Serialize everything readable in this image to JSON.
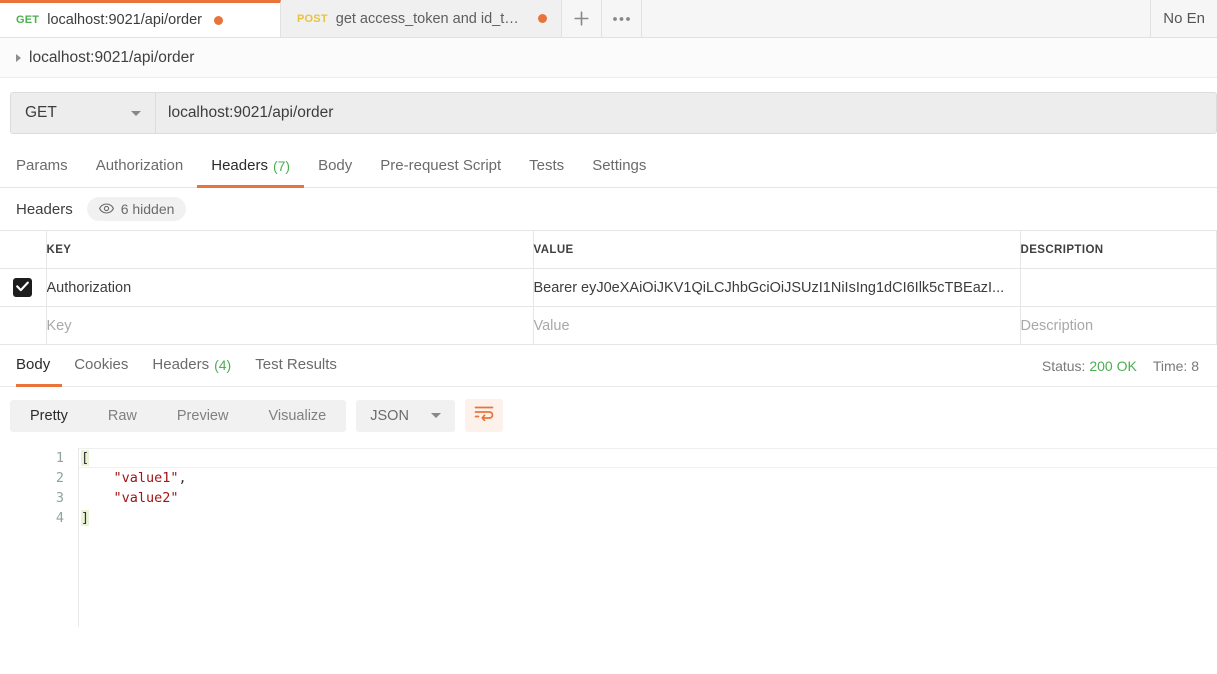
{
  "tabbar": {
    "tabs": [
      {
        "method": "GET",
        "title": "localhost:9021/api/order",
        "unsaved": true,
        "active": true
      },
      {
        "method": "POST",
        "title": "get access_token and id_token",
        "unsaved": true,
        "active": false
      }
    ],
    "new_tab_label": "+",
    "more_label": "•••",
    "environment": "No En"
  },
  "breadcrumb": {
    "text": "localhost:9021/api/order"
  },
  "urlbar": {
    "method": "GET",
    "url": "localhost:9021/api/order"
  },
  "request_tabs": [
    {
      "label": "Params",
      "count": "",
      "active": false
    },
    {
      "label": "Authorization",
      "count": "",
      "active": false
    },
    {
      "label": "Headers",
      "count": "(7)",
      "active": true
    },
    {
      "label": "Body",
      "count": "",
      "active": false
    },
    {
      "label": "Pre-request Script",
      "count": "",
      "active": false
    },
    {
      "label": "Tests",
      "count": "",
      "active": false
    },
    {
      "label": "Settings",
      "count": "",
      "active": false
    }
  ],
  "headers_sub": {
    "title": "Headers",
    "hidden_label": "6 hidden"
  },
  "headers_table": {
    "columns": [
      "KEY",
      "VALUE",
      "DESCRIPTION"
    ],
    "rows": [
      {
        "checked": true,
        "key": "Authorization",
        "value": "Bearer eyJ0eXAiOiJKV1QiLCJhbGciOiJSUzI1NiIsIng1dCI6Ilk5cTBEazI...",
        "description": ""
      }
    ],
    "placeholder_row": {
      "key": "Key",
      "value": "Value",
      "description": "Description"
    }
  },
  "response_tabs": [
    {
      "label": "Body",
      "count": "",
      "active": true
    },
    {
      "label": "Cookies",
      "count": "",
      "active": false
    },
    {
      "label": "Headers",
      "count": "(4)",
      "active": false
    },
    {
      "label": "Test Results",
      "count": "",
      "active": false
    }
  ],
  "response_meta": {
    "status_label": "Status:",
    "status_value": "200 OK",
    "time_label": "Time:",
    "time_value": "8"
  },
  "view_toolbar": {
    "segments": [
      {
        "label": "Pretty",
        "active": true
      },
      {
        "label": "Raw",
        "active": false
      },
      {
        "label": "Preview",
        "active": false
      },
      {
        "label": "Visualize",
        "active": false
      }
    ],
    "format": "JSON",
    "wrap_icon": "word-wrap-icon"
  },
  "response_body": {
    "line_numbers": [
      "1",
      "2",
      "3",
      "4"
    ],
    "lines": [
      {
        "indent": "",
        "open": "[",
        "text": "",
        "comma": ""
      },
      {
        "indent": "    ",
        "open": "",
        "text": "\"value1\"",
        "comma": ","
      },
      {
        "indent": "    ",
        "open": "",
        "text": "\"value2\"",
        "comma": ""
      },
      {
        "indent": "",
        "open": "]",
        "text": "",
        "comma": ""
      }
    ]
  },
  "colors": {
    "accent": "#e8743b",
    "get": "#4caf50",
    "post": "#e8c33c",
    "status_ok": "#4caf50",
    "string": "#a31515"
  }
}
